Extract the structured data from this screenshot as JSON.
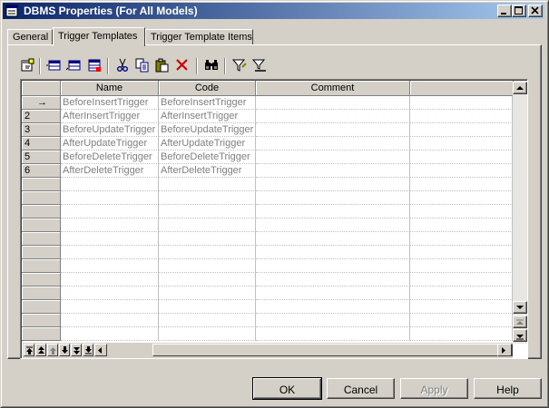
{
  "window": {
    "title": "DBMS Properties (For All Models)"
  },
  "tabs": [
    {
      "label": "General"
    },
    {
      "label": "Trigger Templates"
    },
    {
      "label": "Trigger Template Items"
    }
  ],
  "toolbar": {
    "icons": [
      "properties-icon",
      "insert-row-icon",
      "add-row-icon",
      "add-rows-icon",
      "cut-icon",
      "copy-icon",
      "paste-icon",
      "delete-icon",
      "find-icon",
      "filter-icon",
      "clear-filter-icon"
    ]
  },
  "grid": {
    "columns": [
      "Name",
      "Code",
      "Comment"
    ],
    "current_row_marker": "→",
    "rows": [
      {
        "num": "",
        "name": "BeforeInsertTrigger",
        "code": "BeforeInsertTrigger",
        "comment": ""
      },
      {
        "num": "2",
        "name": "AfterInsertTrigger",
        "code": "AfterInsertTrigger",
        "comment": ""
      },
      {
        "num": "3",
        "name": "BeforeUpdateTrigger",
        "code": "BeforeUpdateTrigger",
        "comment": ""
      },
      {
        "num": "4",
        "name": "AfterUpdateTrigger",
        "code": "AfterUpdateTrigger",
        "comment": ""
      },
      {
        "num": "5",
        "name": "BeforeDeleteTrigger",
        "code": "BeforeDeleteTrigger",
        "comment": ""
      },
      {
        "num": "6",
        "name": "AfterDeleteTrigger",
        "code": "AfterDeleteTrigger",
        "comment": ""
      }
    ],
    "empty_rows": 12
  },
  "buttons": {
    "ok": "OK",
    "cancel": "Cancel",
    "apply": "Apply",
    "help": "Help"
  }
}
